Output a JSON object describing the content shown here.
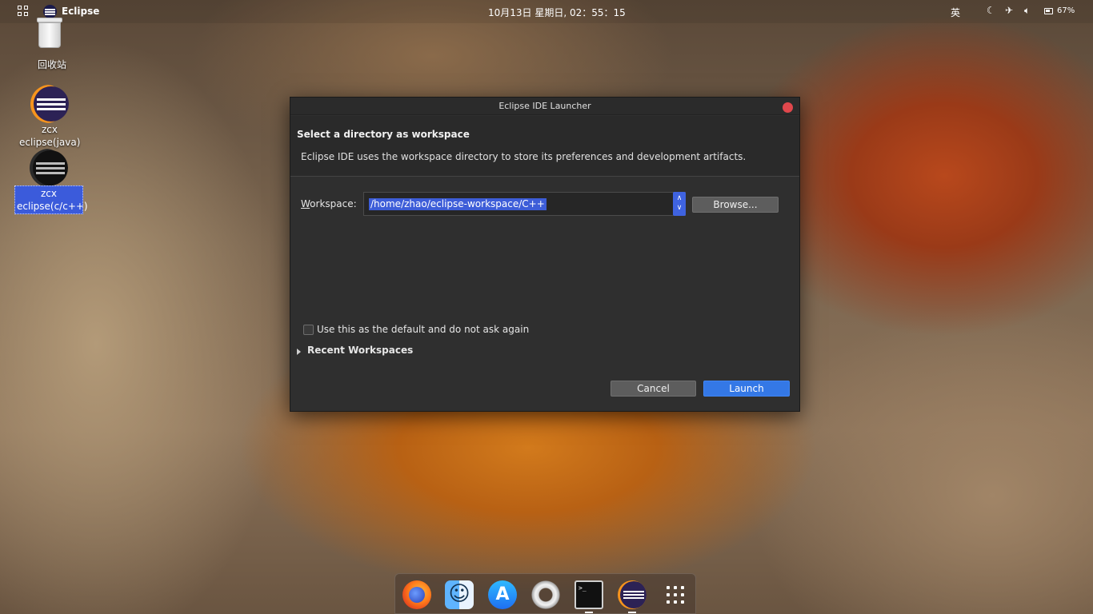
{
  "topbar": {
    "app_name": "Eclipse",
    "clock": "10月13日 星期日, 02：55：15",
    "ime": "英",
    "battery_percent": "67%"
  },
  "desktop": {
    "icons": [
      {
        "label": "回收站",
        "icon": "trash-icon"
      },
      {
        "label": "zcx eclipse(java)",
        "icon": "eclipse-icon"
      },
      {
        "label": "zcx eclipse(c/c++)",
        "icon": "eclipse-icon",
        "selected": true
      }
    ]
  },
  "dialog": {
    "title": "Eclipse IDE Launcher",
    "heading": "Select a directory as workspace",
    "description": "Eclipse IDE uses the workspace directory to store its preferences and development artifacts.",
    "workspace_label_first": "W",
    "workspace_label_rest": "orkspace:",
    "workspace_value": "/home/zhao/eclipse-workspace/C++",
    "browse_label": "Browse...",
    "default_checkbox_label": "Use this as the default and do not ask again",
    "default_checked": false,
    "recent_label": "Recent Workspaces",
    "cancel_label": "Cancel",
    "launch_label": "Launch"
  },
  "dock": {
    "items": [
      "firefox-icon",
      "finder-icon",
      "app-store-icon",
      "ring-icon",
      "terminal-icon",
      "eclipse-icon",
      "app-grid-icon"
    ],
    "terminal_prompt": ">_"
  },
  "colors": {
    "accent": "#3478e6",
    "selection": "#3d5dd8",
    "close": "#e0474c",
    "dialog_bg": "#2f2f2f"
  }
}
